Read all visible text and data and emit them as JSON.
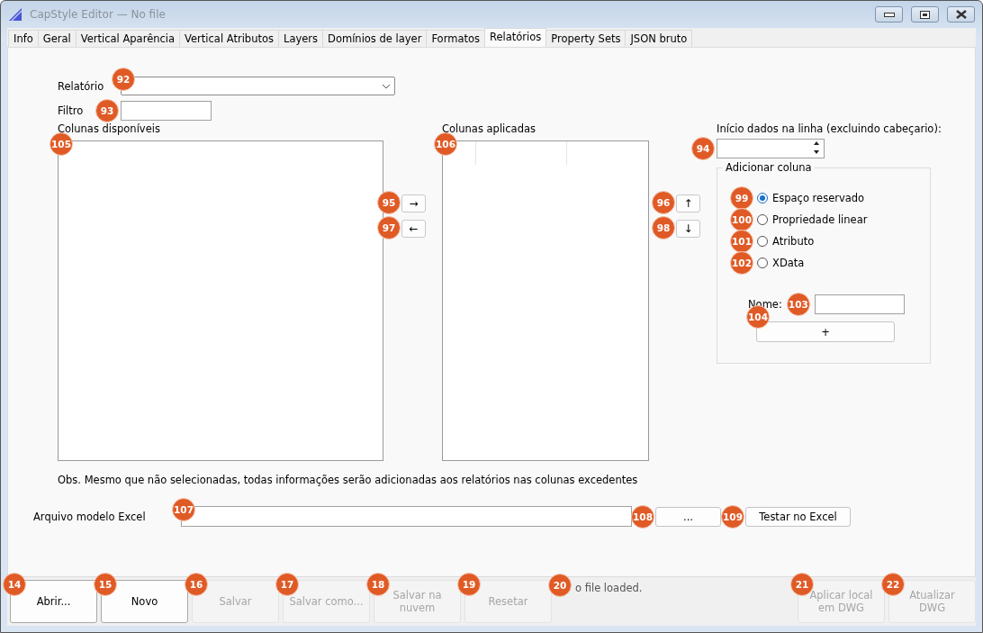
{
  "window": {
    "title": "CapStyle Editor — No file"
  },
  "tabs": [
    {
      "label": "Info",
      "selected": false
    },
    {
      "label": "Geral",
      "selected": false
    },
    {
      "label": "Vertical Aparência",
      "selected": false
    },
    {
      "label": "Vertical Atributos",
      "selected": false
    },
    {
      "label": "Layers",
      "selected": false
    },
    {
      "label": "Domínios de layer",
      "selected": false
    },
    {
      "label": "Formatos",
      "selected": false
    },
    {
      "label": "Relatórios",
      "selected": true
    },
    {
      "label": "Property Sets",
      "selected": false
    },
    {
      "label": "JSON bruto",
      "selected": false
    }
  ],
  "report": {
    "label": "Relatório",
    "marker": "92"
  },
  "filter": {
    "label": "Filtro",
    "marker": "93"
  },
  "available_columns": {
    "label": "Colunas disponíveis",
    "marker": "105"
  },
  "applied_columns": {
    "label": "Colunas aplicadas",
    "marker": "106"
  },
  "move_buttons": [
    {
      "label": "→",
      "marker": "95"
    },
    {
      "label": "←",
      "marker": "97"
    }
  ],
  "order_buttons": [
    {
      "label": "↑",
      "marker": "96"
    },
    {
      "label": "↓",
      "marker": "98"
    }
  ],
  "start_row": {
    "label": "Início dados na linha (excluindo cabeçario):",
    "marker": "94"
  },
  "add_column": {
    "title": "Adicionar coluna",
    "options": [
      {
        "label": "Espaço reservado",
        "selected": true,
        "marker": "99"
      },
      {
        "label": "Propriedade linear",
        "selected": false,
        "marker": "100"
      },
      {
        "label": "Atributo",
        "selected": false,
        "marker": "101"
      },
      {
        "label": "XData",
        "selected": false,
        "marker": "102"
      }
    ],
    "name_label": "Nome:",
    "name_marker": "103",
    "add_button": "+",
    "add_marker": "104"
  },
  "note": "Obs. Mesmo que não selecionadas, todas informações serão adicionadas aos relatórios nas colunas excedentes",
  "template": {
    "label": "Arquivo modelo Excel",
    "marker": "107",
    "browse": "...",
    "browse_marker": "108",
    "test": "Testar no Excel",
    "test_marker": "109"
  },
  "footer": {
    "buttons_left": [
      {
        "label": "Abrir...",
        "disabled": false,
        "marker": "14"
      },
      {
        "label": "Novo",
        "disabled": false,
        "marker": "15"
      },
      {
        "label": "Salvar",
        "disabled": true,
        "marker": "16"
      },
      {
        "label": "Salvar como...",
        "disabled": true,
        "marker": "17"
      },
      {
        "label": "Salvar na nuvem",
        "disabled": true,
        "marker": "18"
      },
      {
        "label": "Resetar",
        "disabled": true,
        "marker": "19"
      }
    ],
    "status": "o file loaded.",
    "status_marker": "20",
    "buttons_right": [
      {
        "label": "Aplicar local em DWG",
        "disabled": true,
        "marker": "21"
      },
      {
        "label": "Atualizar DWG",
        "disabled": true,
        "marker": "22"
      }
    ]
  }
}
